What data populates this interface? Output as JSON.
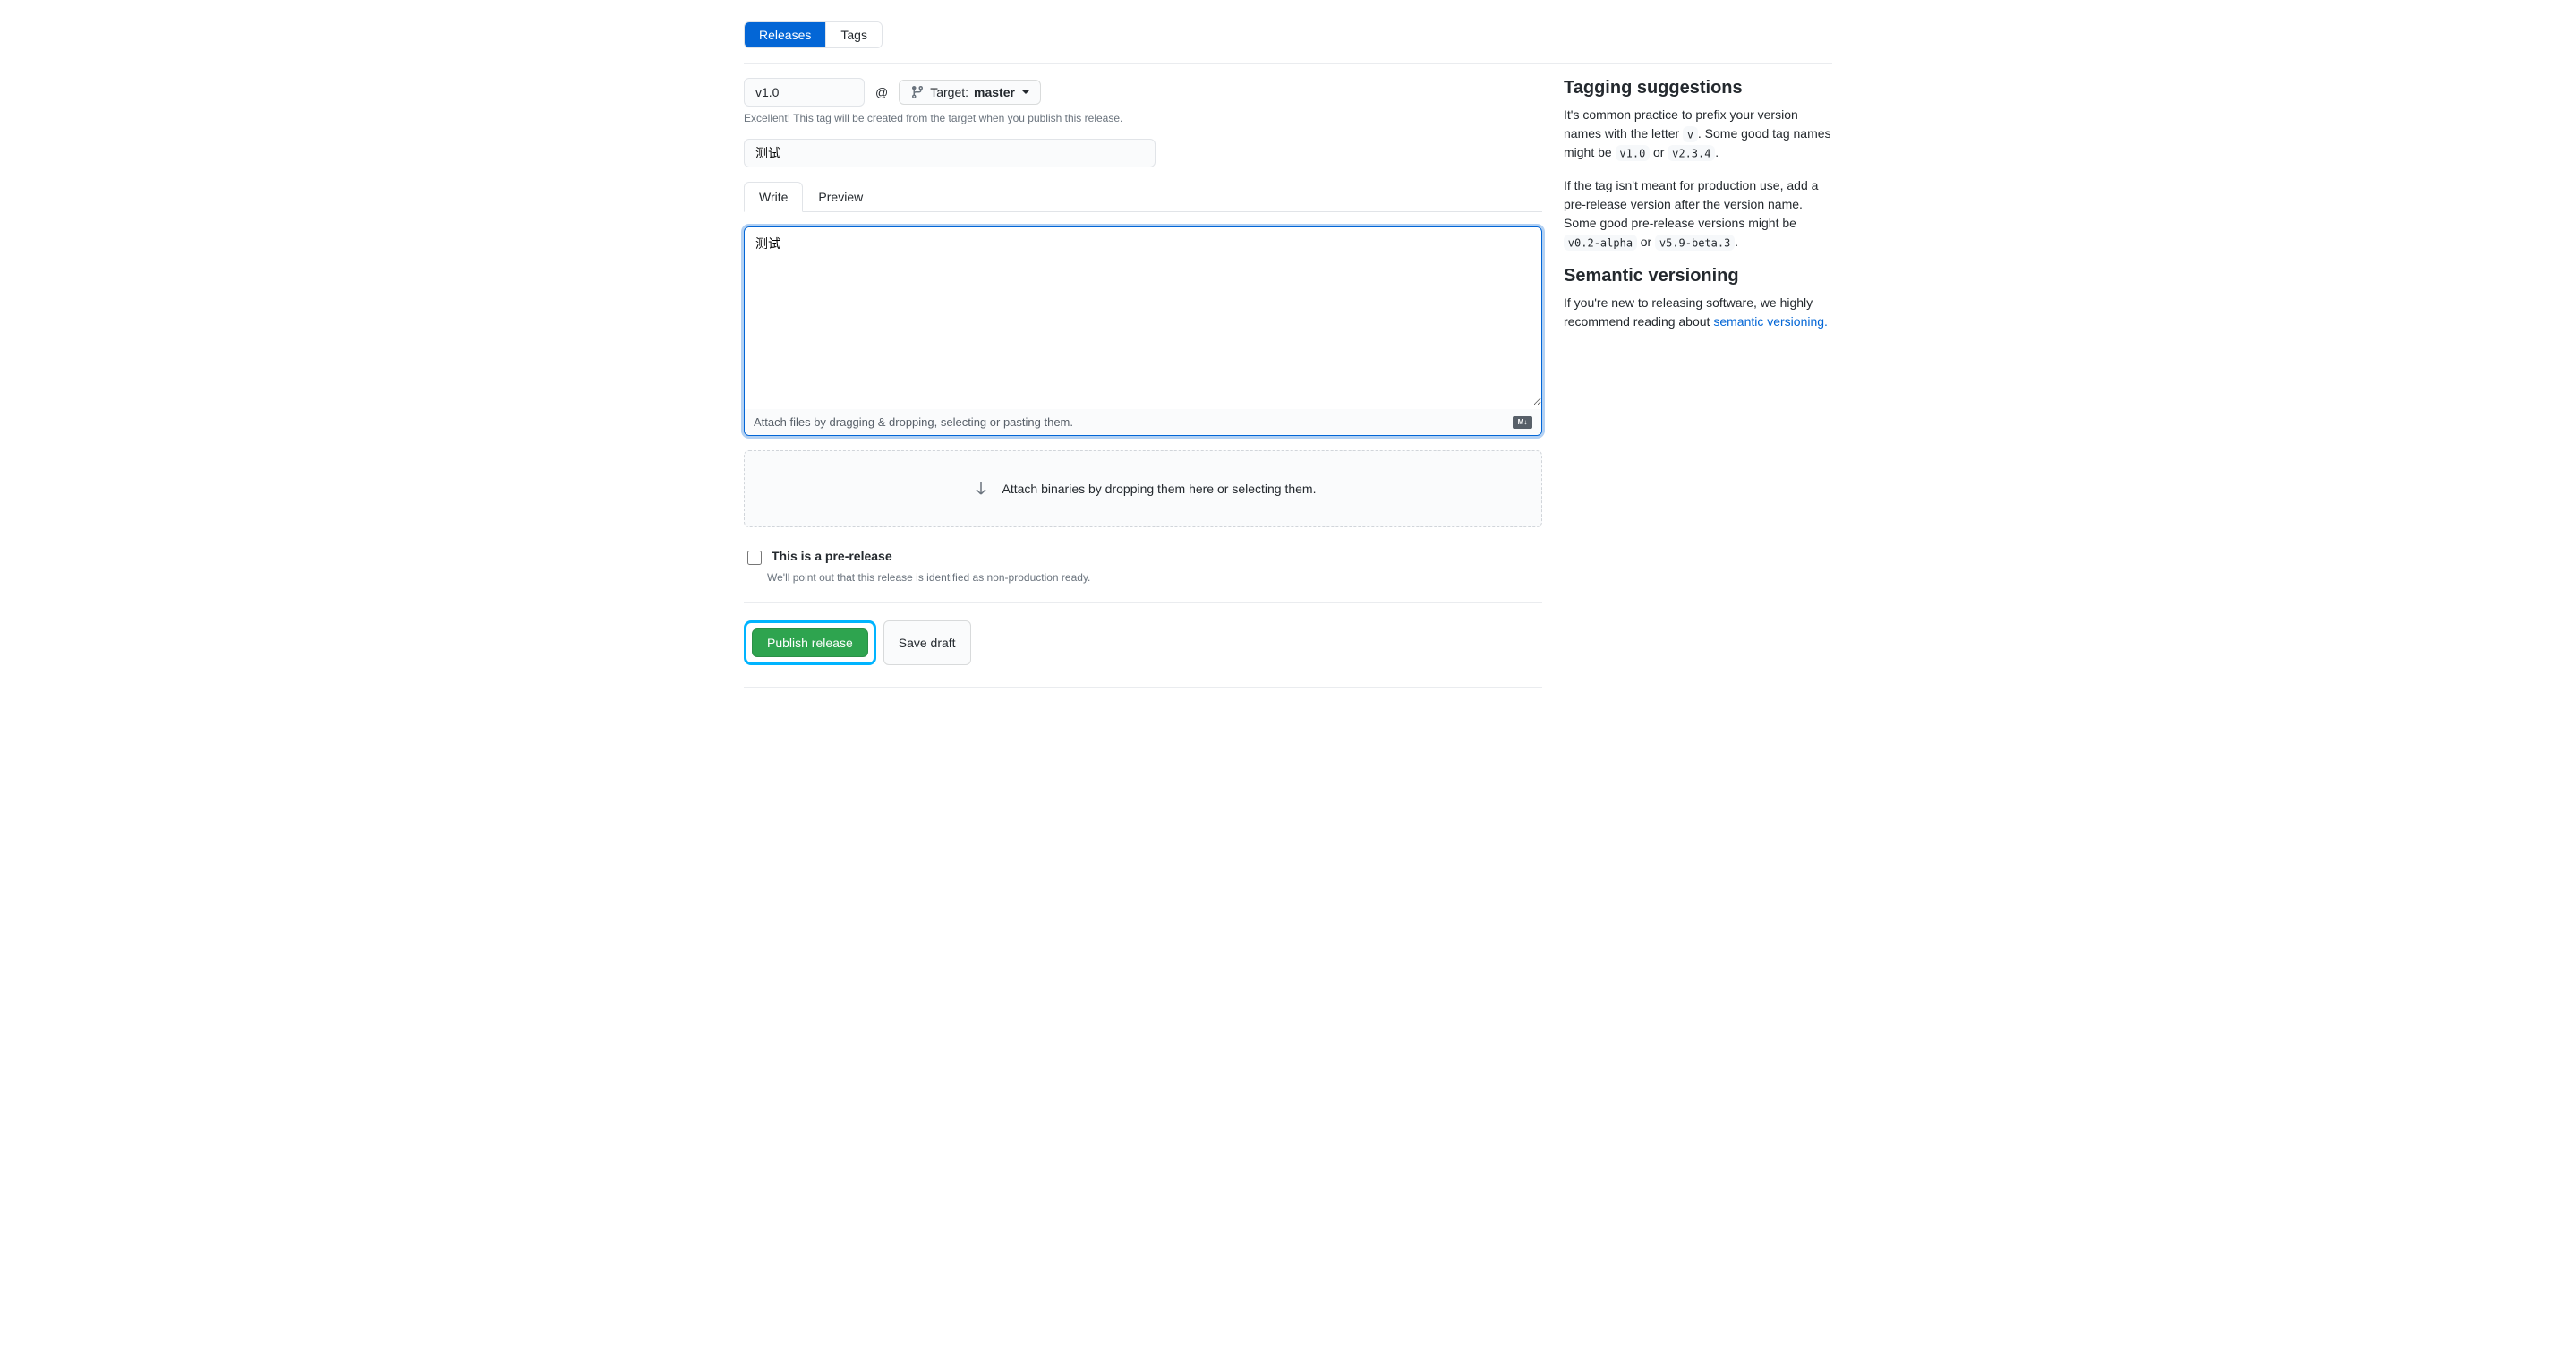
{
  "subnav": {
    "releases": "Releases",
    "tags": "Tags"
  },
  "tag": {
    "value": "v1.0"
  },
  "at_symbol": "@",
  "target": {
    "label": "Target:",
    "branch": "master"
  },
  "tag_note": "Excellent! This tag will be created from the target when you publish this release.",
  "release_title": {
    "value": "测试"
  },
  "tabs": {
    "write": "Write",
    "preview": "Preview"
  },
  "description": {
    "value": "测试"
  },
  "attach_hint": "Attach files by dragging & dropping, selecting or pasting them.",
  "binaries_hint": "Attach binaries by dropping them here or selecting them.",
  "prerelease": {
    "label": "This is a pre-release",
    "note": "We'll point out that this release is identified as non-production ready."
  },
  "buttons": {
    "publish": "Publish release",
    "draft": "Save draft"
  },
  "sidebar": {
    "tagging_title": "Tagging suggestions",
    "tagging_p1_a": "It's common practice to prefix your version names with the letter ",
    "tagging_p1_b": ". Some good tag names might be ",
    "tagging_p1_or": " or ",
    "tagging_p1_end": ".",
    "code_v": "v",
    "code_v10": "v1.0",
    "code_v234": "v2.3.4",
    "tagging_p2_a": "If the tag isn't meant for production use, add a pre-release version after the version name. Some good pre-release versions might be ",
    "tagging_p2_or": " or ",
    "tagging_p2_end": ".",
    "code_alpha": "v0.2-alpha",
    "code_beta": "v5.9-beta.3",
    "semver_title": "Semantic versioning",
    "semver_p_a": "If you're new to releasing software, we highly recommend reading about ",
    "semver_link": "semantic versioning.",
    "md_badge": "M↓"
  }
}
